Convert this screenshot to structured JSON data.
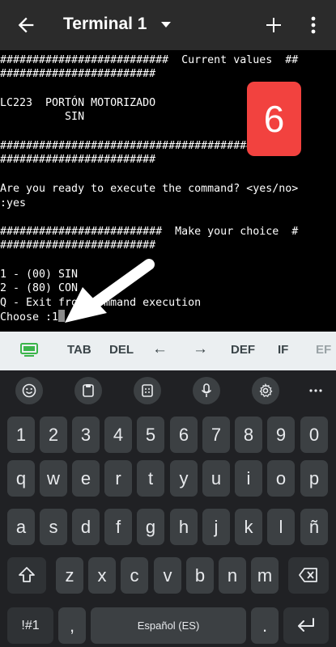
{
  "appbar": {
    "title": "Terminal 1"
  },
  "terminal": {
    "lines": [
      "##########################  Current values  ##",
      "########################",
      "",
      "LC223  PORTÓN MOTORIZADO",
      "          SIN",
      "",
      "############################################",
      "########################",
      "",
      "Are you ready to execute the command? <yes/no>",
      ":yes",
      "",
      "#########################  Make your choice  #",
      "########################",
      "",
      "1 - (00) SIN",
      "2 - (80) CON",
      "Q - Exit from command execution",
      "Choose :1"
    ]
  },
  "badge": {
    "text": "6"
  },
  "extra_keys": [
    "TAB",
    "DEL",
    "←",
    "→",
    "DEF",
    "IF",
    "EF"
  ],
  "keyboard": {
    "row_numbers": [
      "1",
      "2",
      "3",
      "4",
      "5",
      "6",
      "7",
      "8",
      "9",
      "0"
    ],
    "row_q": [
      "q",
      "w",
      "e",
      "r",
      "t",
      "y",
      "u",
      "i",
      "o",
      "p"
    ],
    "row_a": [
      "a",
      "s",
      "d",
      "f",
      "g",
      "h",
      "j",
      "k",
      "l",
      "ñ"
    ],
    "row_z": [
      "z",
      "x",
      "c",
      "v",
      "b",
      "n",
      "m"
    ],
    "symbols_label": "!#1",
    "comma_label": ",",
    "space_label": "Español (ES)",
    "period_label": "."
  },
  "icons": {
    "back": "arrow-left-icon",
    "dropdown": "triangle-down-icon",
    "add": "plus-icon",
    "menu": "more-vert-icon",
    "keyboard_toggle": "keyboard-icon",
    "emoji": "emoji-icon",
    "clipboard": "clipboard-icon",
    "one_hand": "one-handed-icon",
    "mic": "mic-icon",
    "settings": "gear-icon",
    "more": "more-horiz-icon",
    "shift": "shift-icon",
    "backspace": "backspace-icon",
    "enter": "enter-icon"
  },
  "colors": {
    "badge": "#f2423f",
    "appbar": "#2b2b2b",
    "terminal_bg": "#000000",
    "extra_bg": "#ebeff1",
    "keyboard_bg": "#202124",
    "key_bg": "#3c4043",
    "keyboard_icon": "#3bb54a"
  }
}
